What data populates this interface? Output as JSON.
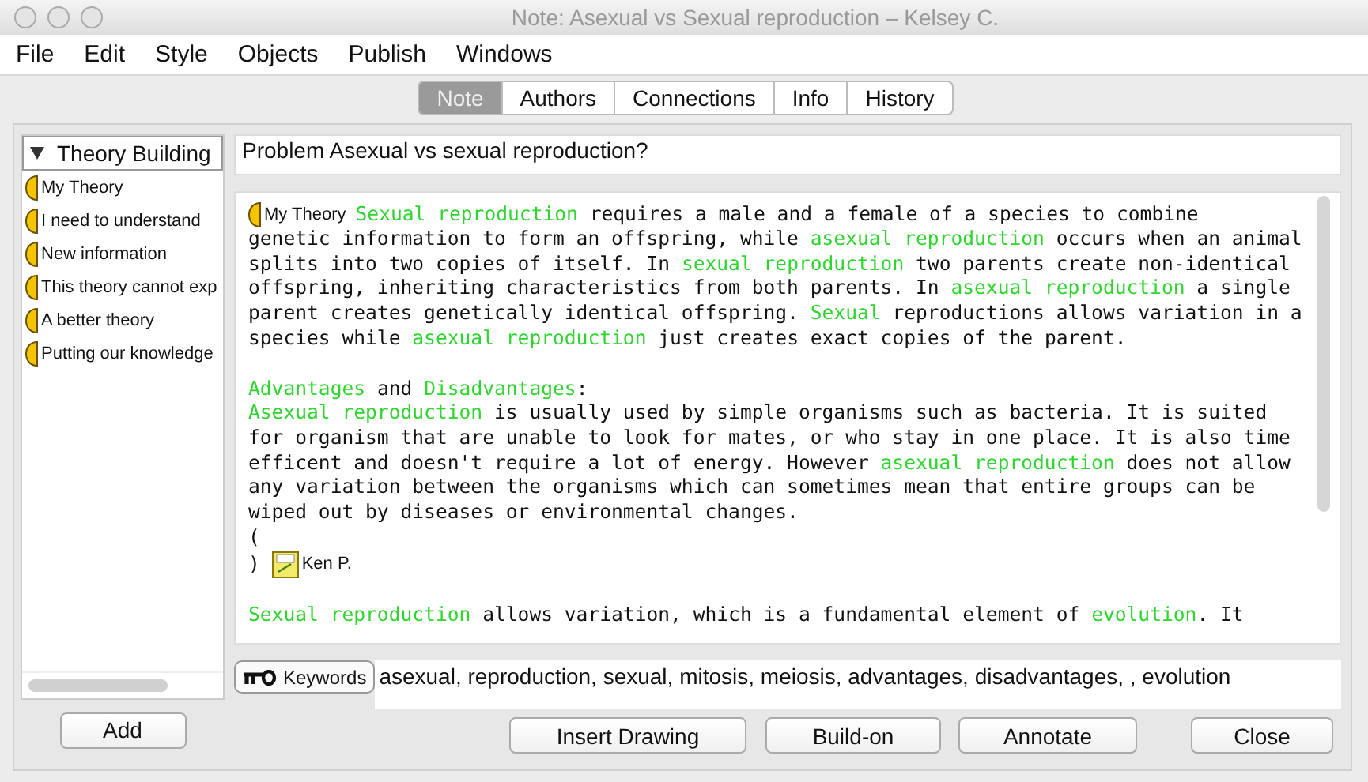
{
  "window": {
    "title": "Note: Asexual vs Sexual reproduction – Kelsey C."
  },
  "menu": [
    "File",
    "Edit",
    "Style",
    "Objects",
    "Publish",
    "Windows"
  ],
  "tabs": [
    {
      "label": "Note",
      "selected": true
    },
    {
      "label": "Authors",
      "selected": false
    },
    {
      "label": "Connections",
      "selected": false
    },
    {
      "label": "Info",
      "selected": false
    },
    {
      "label": "History",
      "selected": false
    }
  ],
  "sidebar": {
    "header": "Theory Building",
    "expanded": true,
    "items": [
      "My Theory",
      "I need to understand",
      "New information",
      "This theory cannot exp",
      "A better theory",
      "Putting our knowledge"
    ],
    "add_button": "Add"
  },
  "note": {
    "title": "Problem Asexual vs sexual reproduction?",
    "body": [
      {
        "lines": [
          [
            {
              "kind": "theory_tag",
              "text": "My Theory"
            },
            {
              "kind": "highlight",
              "text": "Sexual reproduction"
            },
            {
              "kind": "text",
              "text": " requires a male and a female of a species to combine"
            }
          ],
          [
            {
              "kind": "text",
              "text": "genetic information to form an offspring, while "
            },
            {
              "kind": "highlight",
              "text": "asexual reproduction"
            },
            {
              "kind": "text",
              "text": " occurs when an animal"
            }
          ],
          [
            {
              "kind": "text",
              "text": "splits into two copies of itself. In "
            },
            {
              "kind": "highlight",
              "text": "sexual reproduction"
            },
            {
              "kind": "text",
              "text": " two parents create non-identical"
            }
          ],
          [
            {
              "kind": "text",
              "text": "offspring, inheriting characteristics from both parents. In "
            },
            {
              "kind": "highlight",
              "text": "asexual reproduction"
            },
            {
              "kind": "text",
              "text": " a single"
            }
          ],
          [
            {
              "kind": "text",
              "text": "parent creates genetically identical offspring. "
            },
            {
              "kind": "highlight",
              "text": "Sexual"
            },
            {
              "kind": "text",
              "text": " reproductions allows variation in a"
            }
          ],
          [
            {
              "kind": "text",
              "text": "species while "
            },
            {
              "kind": "highlight",
              "text": "asexual reproduction"
            },
            {
              "kind": "text",
              "text": " just creates exact copies of the parent."
            }
          ]
        ]
      },
      {
        "lines": [
          [
            {
              "kind": "highlight",
              "text": "Advantages"
            },
            {
              "kind": "text",
              "text": " and "
            },
            {
              "kind": "highlight",
              "text": "Disadvantages"
            },
            {
              "kind": "text",
              "text": ":"
            }
          ],
          [
            {
              "kind": "highlight",
              "text": "Asexual reproduction"
            },
            {
              "kind": "text",
              "text": " is usually used by simple organisms such as bacteria. It is suited"
            }
          ],
          [
            {
              "kind": "text",
              "text": "for organism that are unable to look for mates, or who stay in one place. It is also time"
            }
          ],
          [
            {
              "kind": "text",
              "text": "efficent and doesn't require a lot of energy. However "
            },
            {
              "kind": "highlight",
              "text": "asexual reproduction"
            },
            {
              "kind": "text",
              "text": " does not allow"
            }
          ],
          [
            {
              "kind": "text",
              "text": "any variation between the organisms which can sometimes mean that entire groups can be"
            }
          ],
          [
            {
              "kind": "text",
              "text": "wiped out by diseases or environmental changes."
            }
          ],
          [
            {
              "kind": "text",
              "text": "("
            }
          ],
          [
            {
              "kind": "text",
              "text": ") "
            },
            {
              "kind": "author_tag",
              "text": "Ken P."
            }
          ]
        ]
      },
      {
        "lines": [
          [
            {
              "kind": "highlight",
              "text": "Sexual reproduction"
            },
            {
              "kind": "text",
              "text": " allows variation, which is a fundamental element of "
            },
            {
              "kind": "highlight",
              "text": "evolution"
            },
            {
              "kind": "text",
              "text": ". It"
            }
          ]
        ]
      }
    ]
  },
  "keywords": {
    "button": "Keywords",
    "value": "asexual, reproduction, sexual, mitosis, meiosis, advantages, disadvantages, , evolution"
  },
  "buttons": [
    "Insert Drawing",
    "Build-on",
    "Annotate",
    "Close"
  ]
}
